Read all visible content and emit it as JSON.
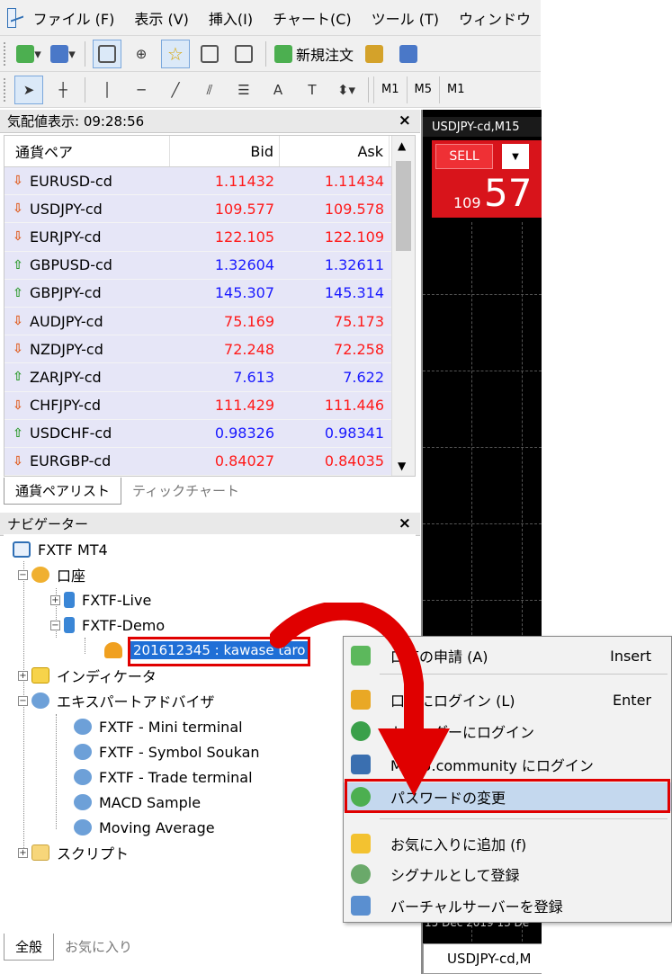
{
  "menu": [
    "ファイル (F)",
    "表示 (V)",
    "挿入(I)",
    "チャート(C)",
    "ツール (T)",
    "ウィンドウ"
  ],
  "toolbar": {
    "new_order": "新規注文"
  },
  "toolbar2": {
    "text_tool": "A",
    "timeframes": [
      "M1",
      "M5",
      "M1"
    ]
  },
  "market_watch": {
    "title": "気配値表示: 09:28:56",
    "col_symbol": "通貨ペア",
    "col_bid": "Bid",
    "col_ask": "Ask",
    "rows": [
      {
        "symbol": "EURUSD-cd",
        "bid": "1.11432",
        "ask": "1.11434",
        "dir": "down"
      },
      {
        "symbol": "USDJPY-cd",
        "bid": "109.577",
        "ask": "109.578",
        "dir": "down"
      },
      {
        "symbol": "EURJPY-cd",
        "bid": "122.105",
        "ask": "122.109",
        "dir": "down"
      },
      {
        "symbol": "GBPUSD-cd",
        "bid": "1.32604",
        "ask": "1.32611",
        "dir": "up"
      },
      {
        "symbol": "GBPJPY-cd",
        "bid": "145.307",
        "ask": "145.314",
        "dir": "up"
      },
      {
        "symbol": "AUDJPY-cd",
        "bid": "75.169",
        "ask": "75.173",
        "dir": "down"
      },
      {
        "symbol": "NZDJPY-cd",
        "bid": "72.248",
        "ask": "72.258",
        "dir": "down"
      },
      {
        "symbol": "ZARJPY-cd",
        "bid": "7.613",
        "ask": "7.622",
        "dir": "up"
      },
      {
        "symbol": "CHFJPY-cd",
        "bid": "111.429",
        "ask": "111.446",
        "dir": "down"
      },
      {
        "symbol": "USDCHF-cd",
        "bid": "0.98326",
        "ask": "0.98341",
        "dir": "up"
      },
      {
        "symbol": "EURGBP-cd",
        "bid": "0.84027",
        "ask": "0.84035",
        "dir": "down"
      }
    ],
    "tabs": [
      "通貨ペアリスト",
      "ティックチャート"
    ]
  },
  "navigator": {
    "title": "ナビゲーター",
    "root": "FXTF MT4",
    "accounts": "口座",
    "live": "FXTF-Live",
    "demo": "FXTF-Demo",
    "account_selected": "201612345 : kawase taro",
    "indicators": "インディケータ",
    "experts": "エキスパートアドバイザ",
    "expert_items": [
      "FXTF - Mini terminal",
      "FXTF - Symbol Soukan",
      "FXTF - Trade terminal",
      "MACD Sample",
      "Moving Average"
    ],
    "scripts": "スクリプト",
    "tabs": [
      "全般",
      "お気に入り"
    ]
  },
  "chart": {
    "title": "USDJPY-cd,M15",
    "sell_label": "SELL",
    "price_small": "109",
    "price_big": "57",
    "date_label": "15 Dec 2019   13 De",
    "bottom_tab": "USDJPY-cd,M"
  },
  "context_menu": {
    "items": [
      {
        "label": "口座の申請 (A)",
        "key": "Insert"
      },
      {
        "label": "口座にログイン (L)",
        "key": "Enter"
      },
      {
        "label": "トレーダーにログイン",
        "key": ""
      },
      {
        "label": "MQL5.community にログイン",
        "key": ""
      },
      {
        "label": "パスワードの変更",
        "key": ""
      },
      {
        "label": "お気に入りに追加 (f)",
        "key": ""
      },
      {
        "label": "シグナルとして登録",
        "key": ""
      },
      {
        "label": "バーチャルサーバーを登録",
        "key": ""
      }
    ]
  },
  "colors": {
    "highlight": "#e00000",
    "selection": "#1f6fd6",
    "bid_down": "#ff1a1a",
    "bid_up": "#1a1aff"
  }
}
